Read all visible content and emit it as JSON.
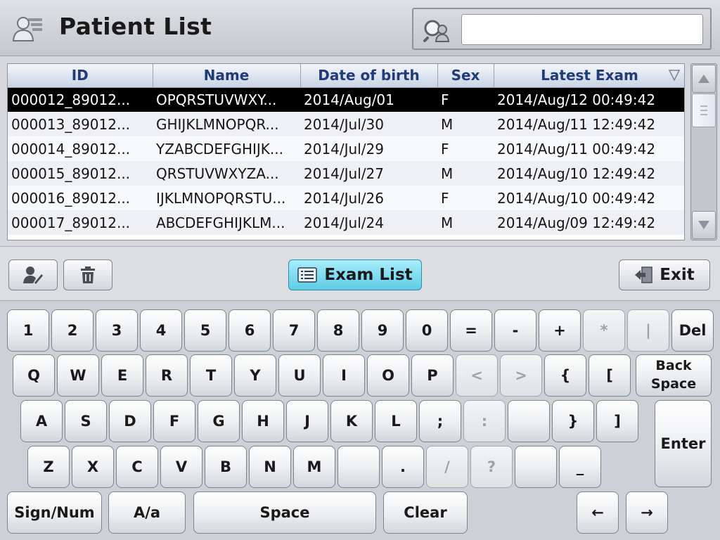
{
  "header": {
    "title": "Patient List",
    "search": {
      "value": "",
      "placeholder": ""
    }
  },
  "table": {
    "columns": [
      "ID",
      "Name",
      "Date of birth",
      "Sex",
      "Latest Exam"
    ],
    "rows": [
      {
        "id": "000012_89012...",
        "name": "OPQRSTUVWXY...",
        "dob": "2014/Aug/01",
        "sex": "F",
        "latest": "2014/Aug/12 00:49:42",
        "selected": true
      },
      {
        "id": "000013_89012...",
        "name": "GHIJKLMNOPQR...",
        "dob": "2014/Jul/30",
        "sex": "M",
        "latest": "2014/Aug/11 12:49:42",
        "selected": false
      },
      {
        "id": "000014_89012...",
        "name": "YZABCDEFGHIJK...",
        "dob": "2014/Jul/29",
        "sex": "F",
        "latest": "2014/Aug/11 00:49:42",
        "selected": false
      },
      {
        "id": "000015_89012...",
        "name": "QRSTUVWXYZA...",
        "dob": "2014/Jul/27",
        "sex": "M",
        "latest": "2014/Aug/10 12:49:42",
        "selected": false
      },
      {
        "id": "000016_89012...",
        "name": "IJKLMNOPQRSTU...",
        "dob": "2014/Jul/26",
        "sex": "F",
        "latest": "2014/Aug/10 00:49:42",
        "selected": false
      },
      {
        "id": "000017_89012...",
        "name": "ABCDEFGHIJKLM...",
        "dob": "2014/Jul/24",
        "sex": "M",
        "latest": "2014/Aug/09 12:49:42",
        "selected": false
      }
    ]
  },
  "toolbar": {
    "edit_icon": "edit-patient-icon",
    "delete_icon": "trash-icon",
    "exam_list_label": "Exam List",
    "exit_label": "Exit"
  },
  "keyboard": {
    "row1": [
      "1",
      "2",
      "3",
      "4",
      "5",
      "6",
      "7",
      "8",
      "9",
      "0",
      "=",
      "-",
      "+",
      "*",
      "|",
      "Del"
    ],
    "row2": [
      "Q",
      "W",
      "E",
      "R",
      "T",
      "Y",
      "U",
      "I",
      "O",
      "P",
      "<",
      ">",
      "{",
      "[",
      "Back Space"
    ],
    "row3": [
      "A",
      "S",
      "D",
      "F",
      "G",
      "H",
      "J",
      "K",
      "L",
      ";",
      ":",
      "",
      "}",
      "]"
    ],
    "row4": [
      "Z",
      "X",
      "C",
      "V",
      "B",
      "N",
      "M",
      "",
      ".",
      "/",
      "?",
      "",
      "_"
    ],
    "enter": "Enter",
    "bottom": [
      "Sign/Num",
      "A/a",
      "Space",
      "Clear",
      "←",
      "→"
    ],
    "disabled": [
      "*",
      "|",
      "<",
      ">",
      ":",
      "/",
      "?"
    ]
  },
  "colors": {
    "selected_row": "#000000",
    "header_text": "#1f3b7a",
    "exam_list_button": "#6fd3ea"
  }
}
